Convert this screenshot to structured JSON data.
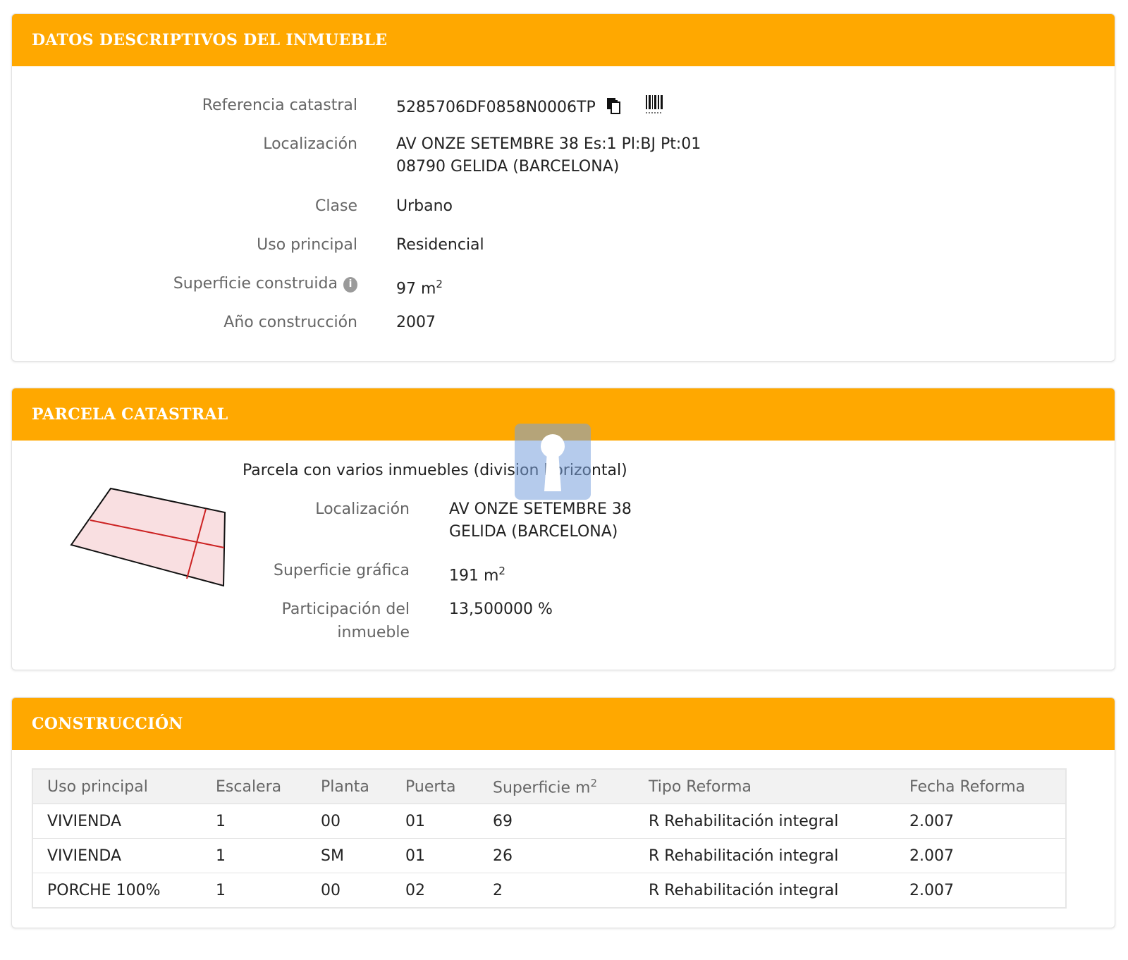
{
  "datos": {
    "title": "DATOS DESCRIPTIVOS DEL INMUEBLE",
    "ref_label": "Referencia catastral",
    "ref_value": "5285706DF0858N0006TP",
    "loc_label": "Localización",
    "loc_line1": "AV ONZE SETEMBRE 38 Es:1 Pl:BJ Pt:01",
    "loc_line2": "08790 GELIDA (BARCELONA)",
    "clase_label": "Clase",
    "clase_value": "Urbano",
    "uso_label": "Uso principal",
    "uso_value": "Residencial",
    "sup_label": "Superficie construida",
    "sup_value": "97 m",
    "sup_unit_exp": "2",
    "anio_label": "Año construcción",
    "anio_value": "2007"
  },
  "parcela": {
    "title": "PARCELA CATASTRAL",
    "subtitle": "Parcela con varios inmuebles (division horizontal)",
    "loc_label": "Localización",
    "loc_line1": "AV ONZE SETEMBRE 38",
    "loc_line2": "GELIDA (BARCELONA)",
    "sup_label": "Superficie gráfica",
    "sup_value": "191 m",
    "sup_unit_exp": "2",
    "part_label_1": "Participación del",
    "part_label_2": "inmueble",
    "part_value": "13,500000 %"
  },
  "construccion": {
    "title": "CONSTRUCCIÓN",
    "headers": [
      "Uso principal",
      "Escalera",
      "Planta",
      "Puerta",
      "Superficie m",
      "Tipo Reforma",
      "Fecha Reforma"
    ],
    "sup_header_exp": "2",
    "rows": [
      [
        "VIVIENDA",
        "1",
        "00",
        "01",
        "69",
        "R Rehabilitación integral",
        "2.007"
      ],
      [
        "VIVIENDA",
        "1",
        "SM",
        "01",
        "26",
        "R Rehabilitación integral",
        "2.007"
      ],
      [
        "PORCHE 100%",
        "1",
        "00",
        "02",
        "2",
        "R Rehabilitación integral",
        "2.007"
      ]
    ]
  },
  "icons": {
    "copy": "copy-icon",
    "barcode": "barcode-icon",
    "info": "info-icon",
    "watermark": "keyhole-watermark"
  },
  "colors": {
    "header_bg": "#ffa800",
    "parcel_fill": "#f9dfe1",
    "parcel_line": "#cc2222"
  }
}
